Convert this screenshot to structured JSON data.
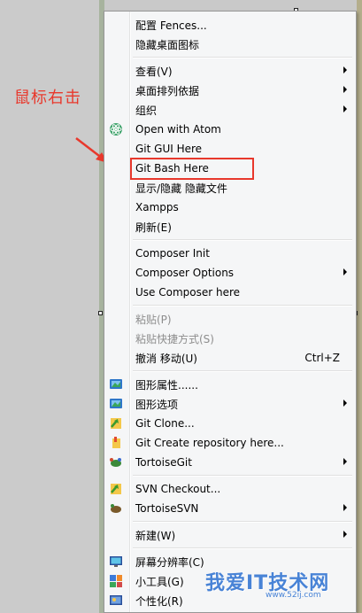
{
  "annotation": {
    "text": "鼠标右击",
    "color": "#e8382c"
  },
  "menu": {
    "groups": [
      [
        {
          "label": "配置 Fences...",
          "icon": "",
          "submenu": false,
          "disabled": false
        },
        {
          "label": "隐藏桌面图标",
          "icon": "",
          "submenu": false,
          "disabled": false
        }
      ],
      [
        {
          "label": "查看(V)",
          "icon": "",
          "submenu": true,
          "disabled": false
        },
        {
          "label": "桌面排列依据",
          "icon": "",
          "submenu": true,
          "disabled": false
        },
        {
          "label": "组织",
          "icon": "",
          "submenu": true,
          "disabled": false
        },
        {
          "label": "Open with Atom",
          "icon": "atom-icon",
          "submenu": false,
          "disabled": false
        },
        {
          "label": "Git GUI Here",
          "icon": "",
          "submenu": false,
          "disabled": false
        },
        {
          "label": "Git Bash Here",
          "icon": "",
          "submenu": false,
          "disabled": false,
          "highlighted": true
        },
        {
          "label": "显示/隐藏 隐藏文件",
          "icon": "",
          "submenu": false,
          "disabled": false
        },
        {
          "label": "Xampps",
          "icon": "",
          "submenu": false,
          "disabled": false
        },
        {
          "label": "刷新(E)",
          "icon": "",
          "submenu": false,
          "disabled": false
        }
      ],
      [
        {
          "label": "Composer Init",
          "icon": "",
          "submenu": false,
          "disabled": false
        },
        {
          "label": "Composer Options",
          "icon": "",
          "submenu": true,
          "disabled": false
        },
        {
          "label": "Use Composer here",
          "icon": "",
          "submenu": false,
          "disabled": false
        }
      ],
      [
        {
          "label": "粘贴(P)",
          "icon": "",
          "submenu": false,
          "disabled": true
        },
        {
          "label": "粘贴快捷方式(S)",
          "icon": "",
          "submenu": false,
          "disabled": true
        },
        {
          "label": "撤消 移动(U)",
          "icon": "",
          "shortcut": "Ctrl+Z",
          "submenu": false,
          "disabled": false
        }
      ],
      [
        {
          "label": "图形属性......",
          "icon": "graphics-icon",
          "submenu": false,
          "disabled": false
        },
        {
          "label": "图形选项",
          "icon": "graphics-icon",
          "submenu": true,
          "disabled": false
        },
        {
          "label": "Git Clone...",
          "icon": "git-clone-icon",
          "submenu": false,
          "disabled": false
        },
        {
          "label": "Git Create repository here...",
          "icon": "git-create-icon",
          "submenu": false,
          "disabled": false
        },
        {
          "label": "TortoiseGit",
          "icon": "tortoise-git-icon",
          "submenu": true,
          "disabled": false
        }
      ],
      [
        {
          "label": "SVN Checkout...",
          "icon": "svn-checkout-icon",
          "submenu": false,
          "disabled": false
        },
        {
          "label": "TortoiseSVN",
          "icon": "tortoise-svn-icon",
          "submenu": true,
          "disabled": false
        }
      ],
      [
        {
          "label": "新建(W)",
          "icon": "",
          "submenu": true,
          "disabled": false
        }
      ],
      [
        {
          "label": "屏幕分辨率(C)",
          "icon": "monitor-icon",
          "submenu": false,
          "disabled": false
        },
        {
          "label": "小工具(G)",
          "icon": "gadgets-icon",
          "submenu": false,
          "disabled": false
        },
        {
          "label": "个性化(R)",
          "icon": "personalize-icon",
          "submenu": false,
          "disabled": false
        }
      ]
    ]
  },
  "watermark": {
    "main": "我爱IT技术网",
    "sub": "www.52ij.com"
  }
}
